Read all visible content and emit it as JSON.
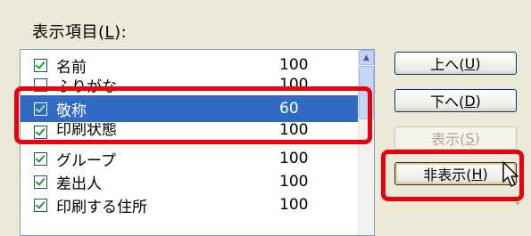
{
  "group": {
    "label_prefix": "表示項目(",
    "hotkey": "L",
    "label_suffix": "):"
  },
  "list": {
    "rows": [
      {
        "name": "名前",
        "value": "100",
        "checked": true
      },
      {
        "name": "ふりがな",
        "value": "100",
        "checked": false
      },
      {
        "name": "敬称",
        "value": "60",
        "checked": true
      },
      {
        "name": "印刷状態",
        "value": "100",
        "checked": true
      },
      {
        "name": "グループ",
        "value": "100",
        "checked": true
      },
      {
        "name": "差出人",
        "value": "100",
        "checked": true
      },
      {
        "name": "印刷する住所",
        "value": "100",
        "checked": true
      }
    ],
    "selected_index": 2
  },
  "buttons": {
    "up": {
      "text": "上へ(",
      "key": "U",
      "end": ")"
    },
    "down": {
      "text": "下へ(",
      "key": "D",
      "end": ")"
    },
    "show": {
      "text": "表示(",
      "key": "S",
      "end": ")"
    },
    "hide": {
      "text": "非表示(",
      "key": "H",
      "end": ")"
    }
  },
  "colors": {
    "highlight": "#e8000b",
    "selection": "#316ac5"
  }
}
